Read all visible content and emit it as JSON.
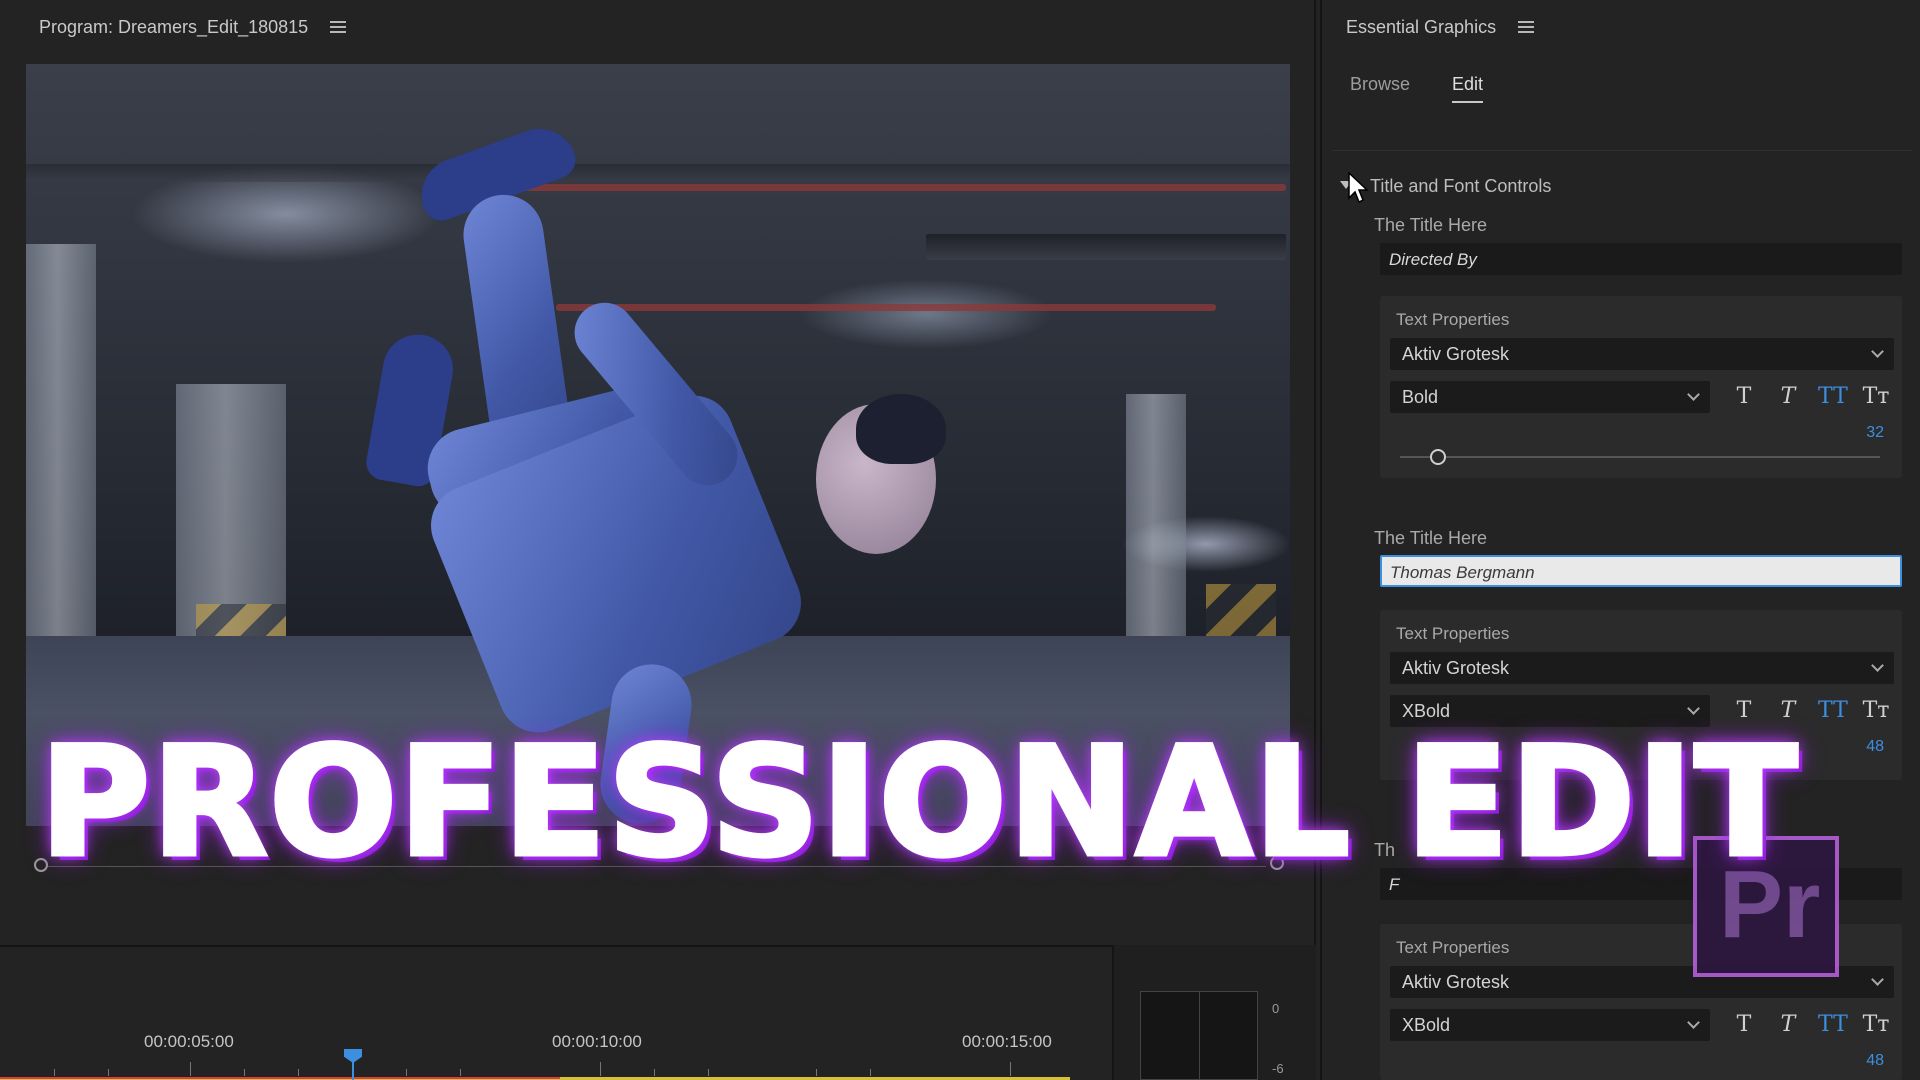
{
  "program": {
    "title": "Program: Dreamers_Edit_180815"
  },
  "timeline": {
    "timecodes": [
      "00:00:05:00",
      "00:00:10:00",
      "00:00:15:00"
    ],
    "meter_labels": [
      "0",
      "-6"
    ]
  },
  "essential_graphics": {
    "title": "Essential Graphics",
    "tabs": [
      {
        "label": "Browse",
        "active": false
      },
      {
        "label": "Edit",
        "active": true
      }
    ],
    "section_title": "Title and Font Controls",
    "fields": [
      {
        "label": "The Title Here",
        "value": "Directed By",
        "text_properties_label": "Text Properties",
        "font": "Aktiv Grotesk",
        "weight": "Bold",
        "size": "32",
        "size_fraction": 0.08
      },
      {
        "label": "The Title Here",
        "value": "Thomas Bergmann",
        "text_properties_label": "Text Properties",
        "font": "Aktiv Grotesk",
        "weight": "XBold",
        "size": "48"
      },
      {
        "label": "Th",
        "value": "F",
        "text_properties_label": "Text Properties",
        "font": "Aktiv Grotesk",
        "weight": "XBold",
        "size": "48"
      }
    ],
    "style_glyphs": [
      "T",
      "T",
      "TT",
      "Tт"
    ]
  },
  "overlay": {
    "text": "PROFESSIONAL EDIT",
    "color": "#b43cff"
  },
  "logo": {
    "text": "Pr"
  }
}
